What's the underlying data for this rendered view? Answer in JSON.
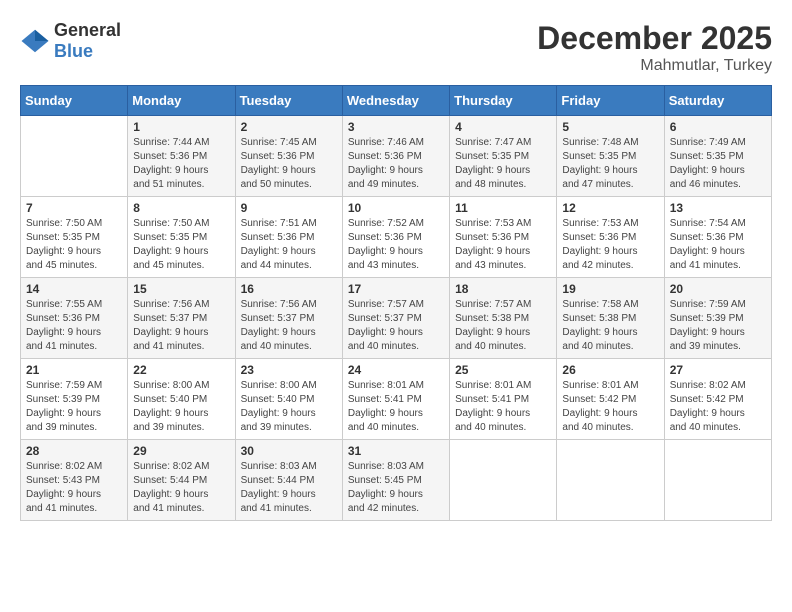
{
  "header": {
    "logo_general": "General",
    "logo_blue": "Blue",
    "month": "December 2025",
    "location": "Mahmutlar, Turkey"
  },
  "weekdays": [
    "Sunday",
    "Monday",
    "Tuesday",
    "Wednesday",
    "Thursday",
    "Friday",
    "Saturday"
  ],
  "weeks": [
    [
      {
        "day": "",
        "content": ""
      },
      {
        "day": "1",
        "content": "Sunrise: 7:44 AM\nSunset: 5:36 PM\nDaylight: 9 hours\nand 51 minutes."
      },
      {
        "day": "2",
        "content": "Sunrise: 7:45 AM\nSunset: 5:36 PM\nDaylight: 9 hours\nand 50 minutes."
      },
      {
        "day": "3",
        "content": "Sunrise: 7:46 AM\nSunset: 5:36 PM\nDaylight: 9 hours\nand 49 minutes."
      },
      {
        "day": "4",
        "content": "Sunrise: 7:47 AM\nSunset: 5:35 PM\nDaylight: 9 hours\nand 48 minutes."
      },
      {
        "day": "5",
        "content": "Sunrise: 7:48 AM\nSunset: 5:35 PM\nDaylight: 9 hours\nand 47 minutes."
      },
      {
        "day": "6",
        "content": "Sunrise: 7:49 AM\nSunset: 5:35 PM\nDaylight: 9 hours\nand 46 minutes."
      }
    ],
    [
      {
        "day": "7",
        "content": "Sunrise: 7:50 AM\nSunset: 5:35 PM\nDaylight: 9 hours\nand 45 minutes."
      },
      {
        "day": "8",
        "content": "Sunrise: 7:50 AM\nSunset: 5:35 PM\nDaylight: 9 hours\nand 45 minutes."
      },
      {
        "day": "9",
        "content": "Sunrise: 7:51 AM\nSunset: 5:36 PM\nDaylight: 9 hours\nand 44 minutes."
      },
      {
        "day": "10",
        "content": "Sunrise: 7:52 AM\nSunset: 5:36 PM\nDaylight: 9 hours\nand 43 minutes."
      },
      {
        "day": "11",
        "content": "Sunrise: 7:53 AM\nSunset: 5:36 PM\nDaylight: 9 hours\nand 43 minutes."
      },
      {
        "day": "12",
        "content": "Sunrise: 7:53 AM\nSunset: 5:36 PM\nDaylight: 9 hours\nand 42 minutes."
      },
      {
        "day": "13",
        "content": "Sunrise: 7:54 AM\nSunset: 5:36 PM\nDaylight: 9 hours\nand 41 minutes."
      }
    ],
    [
      {
        "day": "14",
        "content": "Sunrise: 7:55 AM\nSunset: 5:36 PM\nDaylight: 9 hours\nand 41 minutes."
      },
      {
        "day": "15",
        "content": "Sunrise: 7:56 AM\nSunset: 5:37 PM\nDaylight: 9 hours\nand 41 minutes."
      },
      {
        "day": "16",
        "content": "Sunrise: 7:56 AM\nSunset: 5:37 PM\nDaylight: 9 hours\nand 40 minutes."
      },
      {
        "day": "17",
        "content": "Sunrise: 7:57 AM\nSunset: 5:37 PM\nDaylight: 9 hours\nand 40 minutes."
      },
      {
        "day": "18",
        "content": "Sunrise: 7:57 AM\nSunset: 5:38 PM\nDaylight: 9 hours\nand 40 minutes."
      },
      {
        "day": "19",
        "content": "Sunrise: 7:58 AM\nSunset: 5:38 PM\nDaylight: 9 hours\nand 40 minutes."
      },
      {
        "day": "20",
        "content": "Sunrise: 7:59 AM\nSunset: 5:39 PM\nDaylight: 9 hours\nand 39 minutes."
      }
    ],
    [
      {
        "day": "21",
        "content": "Sunrise: 7:59 AM\nSunset: 5:39 PM\nDaylight: 9 hours\nand 39 minutes."
      },
      {
        "day": "22",
        "content": "Sunrise: 8:00 AM\nSunset: 5:40 PM\nDaylight: 9 hours\nand 39 minutes."
      },
      {
        "day": "23",
        "content": "Sunrise: 8:00 AM\nSunset: 5:40 PM\nDaylight: 9 hours\nand 39 minutes."
      },
      {
        "day": "24",
        "content": "Sunrise: 8:01 AM\nSunset: 5:41 PM\nDaylight: 9 hours\nand 40 minutes."
      },
      {
        "day": "25",
        "content": "Sunrise: 8:01 AM\nSunset: 5:41 PM\nDaylight: 9 hours\nand 40 minutes."
      },
      {
        "day": "26",
        "content": "Sunrise: 8:01 AM\nSunset: 5:42 PM\nDaylight: 9 hours\nand 40 minutes."
      },
      {
        "day": "27",
        "content": "Sunrise: 8:02 AM\nSunset: 5:42 PM\nDaylight: 9 hours\nand 40 minutes."
      }
    ],
    [
      {
        "day": "28",
        "content": "Sunrise: 8:02 AM\nSunset: 5:43 PM\nDaylight: 9 hours\nand 41 minutes."
      },
      {
        "day": "29",
        "content": "Sunrise: 8:02 AM\nSunset: 5:44 PM\nDaylight: 9 hours\nand 41 minutes."
      },
      {
        "day": "30",
        "content": "Sunrise: 8:03 AM\nSunset: 5:44 PM\nDaylight: 9 hours\nand 41 minutes."
      },
      {
        "day": "31",
        "content": "Sunrise: 8:03 AM\nSunset: 5:45 PM\nDaylight: 9 hours\nand 42 minutes."
      },
      {
        "day": "",
        "content": ""
      },
      {
        "day": "",
        "content": ""
      },
      {
        "day": "",
        "content": ""
      }
    ]
  ]
}
